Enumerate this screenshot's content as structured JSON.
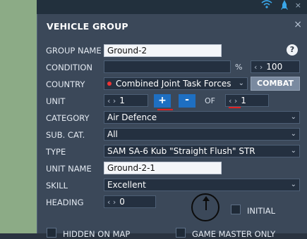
{
  "dialog": {
    "title": "VEHICLE GROUP"
  },
  "fields": {
    "group_name": {
      "label": "GROUP NAME",
      "value": "Ground-2",
      "help": "?"
    },
    "condition": {
      "label": "CONDITION",
      "value": "",
      "unit": "%",
      "percent": "100"
    },
    "country": {
      "label": "COUNTRY",
      "value": "Combined Joint Task Forces",
      "mode_button": "COMBAT"
    },
    "unit": {
      "label": "UNIT",
      "value": "1",
      "add": "+",
      "remove": "-",
      "of": "OF",
      "total": "1"
    },
    "category": {
      "label": "CATEGORY",
      "value": "Air Defence"
    },
    "sub_cat": {
      "label": "SUB. CAT.",
      "value": "All"
    },
    "type": {
      "label": "TYPE",
      "value": "SAM SA-6 Kub \"Straight Flush\" STR"
    },
    "unit_name": {
      "label": "UNIT NAME",
      "value": "Ground-2-1"
    },
    "skill": {
      "label": "SKILL",
      "value": "Excellent"
    },
    "heading": {
      "label": "HEADING",
      "value": "0",
      "initial": "INITIAL"
    }
  },
  "bottom": {
    "hidden_on_map": "HIDDEN ON MAP",
    "game_master_only": "GAME MASTER ONLY"
  },
  "icons": {
    "arrows": "‹ ›",
    "chevron": "⌄",
    "close": "×"
  },
  "colors": {
    "panel": "#3b4859",
    "accent_blue": "#1e6fc2",
    "combat_button": "#7a8aa0",
    "country_dot": "#e33333"
  }
}
